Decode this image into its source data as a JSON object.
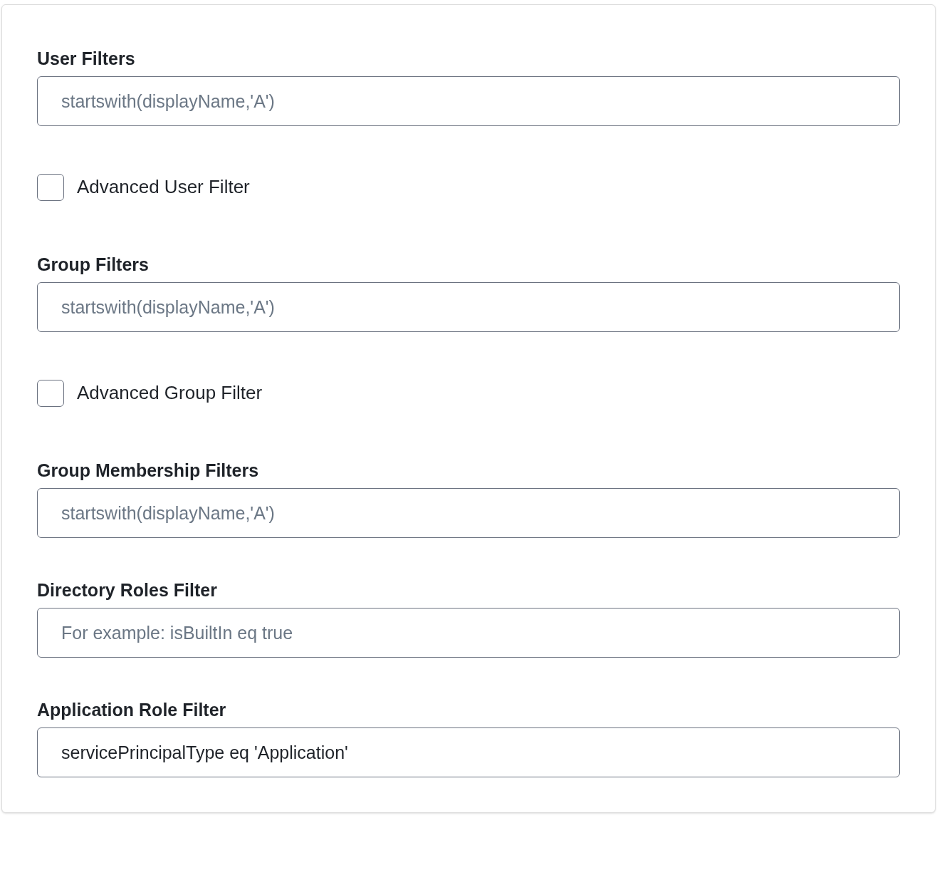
{
  "items": [
    {
      "kind": "field",
      "label": "User Filters",
      "placeholder": "startswith(displayName,'A')"
    },
    {
      "kind": "checkbox",
      "label": "Advanced User Filter",
      "checked": false
    },
    {
      "kind": "field",
      "label": "Group Filters",
      "placeholder": "startswith(displayName,'A')"
    },
    {
      "kind": "checkbox",
      "label": "Advanced Group Filter",
      "checked": false
    },
    {
      "kind": "field",
      "label": "Group Membership Filters",
      "placeholder": "startswith(displayName,'A')"
    },
    {
      "kind": "field",
      "label": "Directory Roles Filter",
      "placeholder": "For example: isBuiltIn eq true"
    },
    {
      "kind": "field",
      "label": "Application Role Filter",
      "value": "servicePrincipalType eq 'Application'"
    }
  ]
}
